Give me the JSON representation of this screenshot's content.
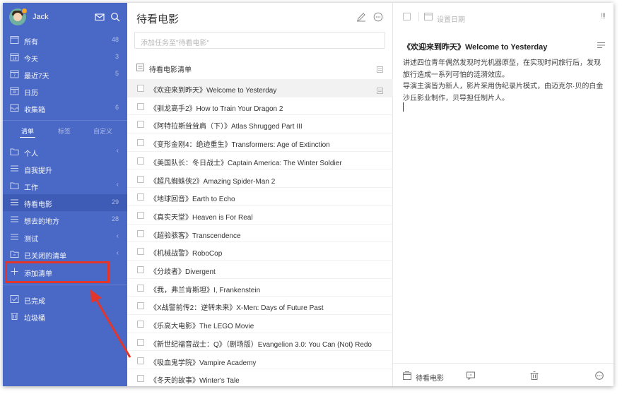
{
  "user": {
    "name": "Jack"
  },
  "sidebar": {
    "smart_lists": [
      {
        "label": "所有",
        "count": "48",
        "icon": "inbox-icon"
      },
      {
        "label": "今天",
        "count": "3",
        "icon": "calendar-today-icon"
      },
      {
        "label": "最近7天",
        "count": "5",
        "icon": "calendar-week-icon"
      },
      {
        "label": "日历",
        "count": "",
        "icon": "calendar-icon"
      },
      {
        "label": "收集箱",
        "count": "6",
        "icon": "collect-box-icon"
      }
    ],
    "tabs": [
      {
        "label": "清单"
      },
      {
        "label": "标签"
      },
      {
        "label": "自定义"
      }
    ],
    "lists": [
      {
        "label": "个人",
        "count": "",
        "icon": "folder-icon",
        "expand": "‹"
      },
      {
        "label": "自我提升",
        "count": "",
        "icon": "list-icon",
        "expand": ""
      },
      {
        "label": "工作",
        "count": "",
        "icon": "folder-icon",
        "expand": "‹"
      },
      {
        "label": "待看电影",
        "count": "29",
        "icon": "list-icon",
        "expand": ""
      },
      {
        "label": "想去的地方",
        "count": "28",
        "icon": "list-icon",
        "expand": ""
      },
      {
        "label": "测试",
        "count": "",
        "icon": "list-icon",
        "expand": "‹"
      },
      {
        "label": "已关闭的清单",
        "count": "",
        "icon": "archive-folder-icon",
        "expand": "‹"
      }
    ],
    "add_list": {
      "label": "添加清单"
    },
    "bottom": [
      {
        "label": "已完成",
        "icon": "completed-icon"
      },
      {
        "label": "垃圾桶",
        "icon": "trash-icon"
      }
    ]
  },
  "middle": {
    "title": "待看电影",
    "add_placeholder": "添加任务至\"待看电影\"",
    "list_header": "待看电影清单",
    "tasks": [
      "《欢迎来到昨天》Welcome to Yesterday",
      "《驯龙高手2》How to Train Your Dragon 2",
      "《阿特拉斯耸耸肩（下）》Atlas Shrugged Part III",
      "《变形金刚4：绝迹重生》Transformers: Age of Extinction",
      "《美国队长：冬日战士》Captain America: The Winter Soldier",
      "《超凡蜘蛛侠2》Amazing Spider-Man 2",
      "《地球回音》Earth to Echo",
      "《真实天堂》Heaven is For Real",
      "《超验骇客》Transcendence",
      "《机械战警》RoboCop",
      "《分歧者》Divergent",
      "《我，弗兰肯斯坦》I, Frankenstein",
      "《X战警前传2：逆转未来》X-Men: Days of Future Past",
      "《乐高大电影》The LEGO Movie",
      "《新世纪福音战士：Q》（剧场版）Evangelion 3.0: You Can (Not) Redo",
      "《吸血鬼学院》Vampire Academy",
      "《冬天的故事》Winter's Tale"
    ]
  },
  "detail": {
    "date_placeholder": "设置日期",
    "priority": "!!!",
    "title": "《欢迎来到昨天》Welcome to Yesterday",
    "body_line1": "讲述四位青年偶然发现时光机器原型，在实现时间旅行后，发现旅行造成一系列可怕的涟漪效应。",
    "body_line2": "导演主演皆为新人，影片采用伪纪录片模式，由迈克尔·贝的白金沙丘影业制作，贝导担任制片人。",
    "list_name": "待看电影"
  },
  "annotation": {
    "color": "#e2352c"
  }
}
